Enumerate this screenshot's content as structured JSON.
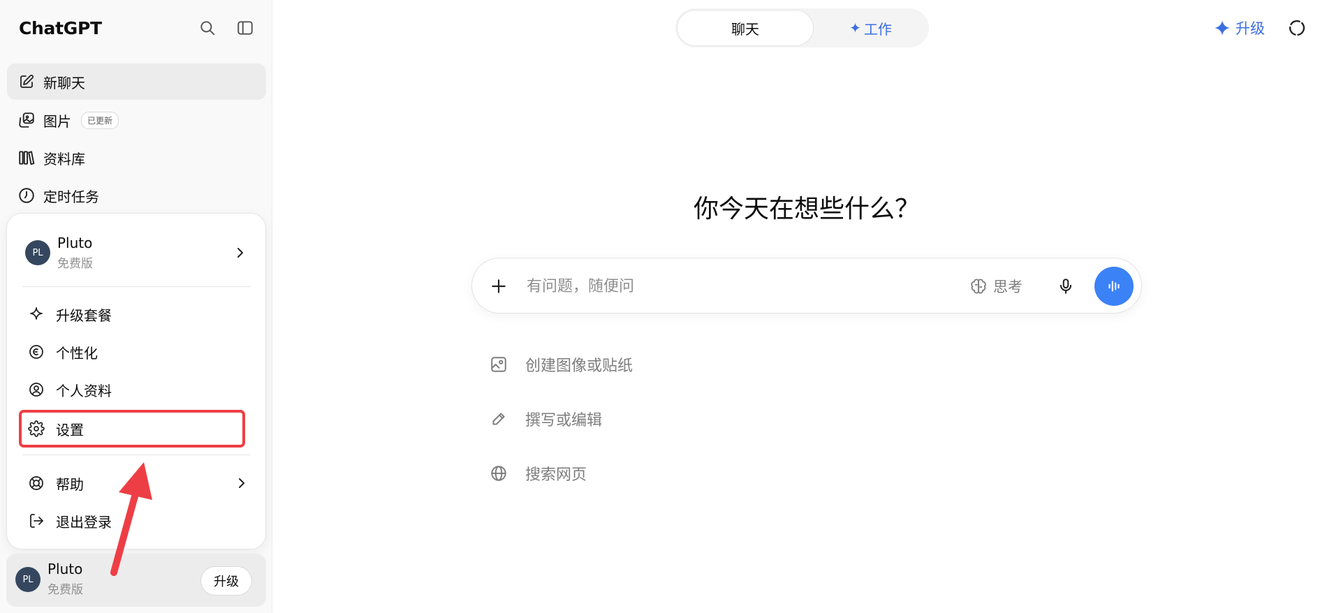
{
  "sidebar": {
    "brand": "ChatGPT",
    "icons": {
      "search": "search-icon",
      "toggle": "sidebar-toggle-icon"
    },
    "nav": [
      {
        "label": "新聊天",
        "icon": "edit-icon"
      },
      {
        "label": "图片",
        "icon": "images-icon",
        "badge": "已更新"
      },
      {
        "label": "资料库",
        "icon": "library-icon"
      },
      {
        "label": "定时任务",
        "icon": "clock-icon"
      }
    ]
  },
  "popup": {
    "user": {
      "initials": "PL",
      "name": "Pluto",
      "plan": "免费版"
    },
    "items": [
      {
        "label": "升级套餐",
        "icon": "sparkle-icon"
      },
      {
        "label": "个性化",
        "icon": "personalize-icon"
      },
      {
        "label": "个人资料",
        "icon": "profile-icon"
      },
      {
        "label": "设置",
        "icon": "gear-icon"
      },
      {
        "label": "帮助",
        "icon": "help-icon"
      },
      {
        "label": "退出登录",
        "icon": "logout-icon"
      }
    ]
  },
  "user_card": {
    "initials": "PL",
    "name": "Pluto",
    "plan": "免费版",
    "upgrade": "升级"
  },
  "header": {
    "tabs": {
      "chat": "聊天",
      "work": "工作"
    },
    "upgrade": "升级"
  },
  "main": {
    "greeting": "你今天在想些什么？",
    "composer": {
      "placeholder": "有问题，随便问",
      "think": "思考"
    },
    "suggestions": [
      {
        "label": "创建图像或贴纸",
        "icon": "image-icon"
      },
      {
        "label": "撰写或编辑",
        "icon": "pencil-icon"
      },
      {
        "label": "搜索网页",
        "icon": "globe-icon"
      }
    ]
  },
  "colors": {
    "accent": "#3b82f6",
    "annotation": "#ee3e45",
    "sidebar_bg": "#f9f9f9"
  }
}
